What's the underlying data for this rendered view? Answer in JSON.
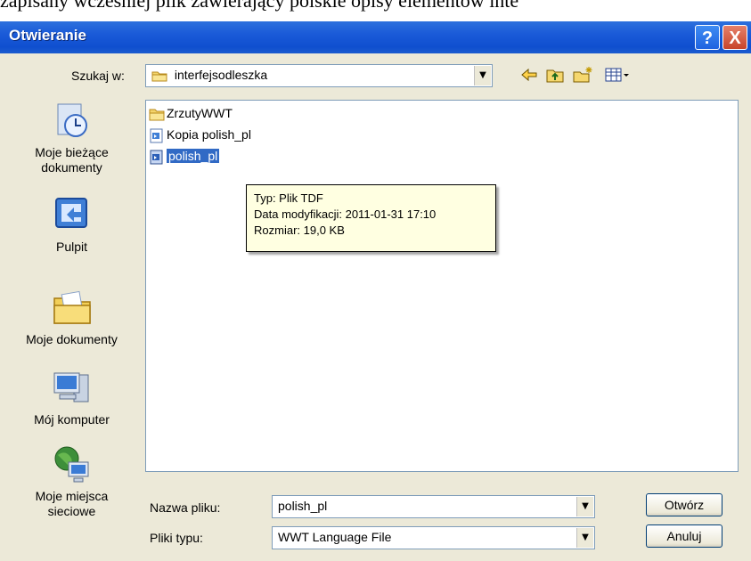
{
  "background_text": "zapisany wcześniej plik zawierający polskie opisy elementów inte",
  "window": {
    "title": "Otwieranie",
    "help_glyph": "?",
    "close_glyph": "X"
  },
  "look_in": {
    "label": "Szukaj w:",
    "value": "interfejsodleszka",
    "icon": "folder-icon"
  },
  "toolbar": {
    "icons": [
      "back-arrow-icon",
      "up-folder-icon",
      "new-folder-icon",
      "view-menu-icon"
    ]
  },
  "places": [
    {
      "label": "Moje bieżące dokumenty",
      "line1": "Moje bieżące",
      "line2": "dokumenty",
      "icon": "recent-documents-icon"
    },
    {
      "label": "Pulpit",
      "icon": "desktop-icon"
    },
    {
      "label": "Moje dokumenty",
      "icon": "my-documents-icon"
    },
    {
      "label": "Mój komputer",
      "icon": "my-computer-icon"
    },
    {
      "label": "Moje miejsca sieciowe",
      "line1": "Moje miejsca",
      "line2": "sieciowe",
      "icon": "network-places-icon"
    }
  ],
  "files": [
    {
      "name": "ZrzutyWWT",
      "type": "folder",
      "selected": false
    },
    {
      "name": "Kopia polish_pl",
      "type": "file",
      "selected": false
    },
    {
      "name": "polish_pl",
      "type": "file",
      "selected": true
    }
  ],
  "tooltip": {
    "type": "Typ: Plik TDF",
    "modified": "Data modyfikacji: 2011-01-31 17:10",
    "size": "Rozmiar: 19,0 KB"
  },
  "filename": {
    "label": "Nazwa pliku:",
    "value": "polish_pl"
  },
  "filetype": {
    "label": "Pliki typu:",
    "value": "WWT Language File"
  },
  "buttons": {
    "open": "Otwórz",
    "cancel": "Anuluj"
  },
  "colors": {
    "titlebar": "#0f4fcf",
    "dialog_bg": "#ece9d8",
    "selection": "#316ac5",
    "tooltip_bg": "#ffffe1"
  }
}
